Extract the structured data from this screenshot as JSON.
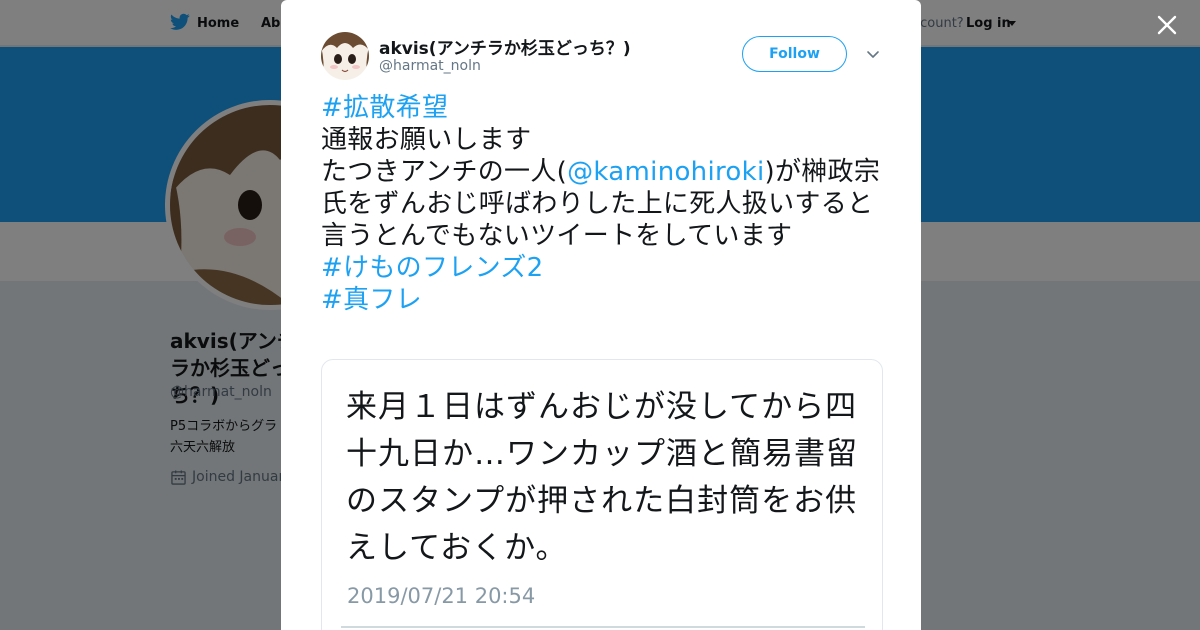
{
  "nav": {
    "home_label": "Home",
    "about_label": "Abo",
    "account_prompt": "account?",
    "login_label": "Log in"
  },
  "profile": {
    "name": "akvis(アンチラか杉玉どっち？)",
    "name_visible": "akvis(アンチラか杉玉どっち？)",
    "handle": "@harmat_noln",
    "bio": "P5コラボからグラ です 六天六解放",
    "joined": "Joined January"
  },
  "tweet": {
    "author_name": "akvis(アンチラか杉玉どっち？)",
    "author_handle": "@harmat_noln",
    "follow_label": "Follow",
    "hashtag_1": "#拡散希望",
    "line_1": "通報お願いします",
    "line_2_before": "たつきアンチの一人(",
    "mention": "@kaminohiroki",
    "line_2_after": ")が榊政宗氏をずんおじ呼ばわりした上に死人扱いすると言うとんでもないツイートをしています",
    "hashtag_2": "#けものフレンズ2",
    "hashtag_3": "#真フレ"
  },
  "media": {
    "text": "来月１日はずんおじが没してから四十九日か…ワンカップ酒と簡易書留のスタンプが押された白封筒をお供えしておくか。",
    "date": "2019/07/21 20:54"
  },
  "colors": {
    "accent": "#1da1f2",
    "text": "#14171a",
    "muted": "#657786"
  },
  "icons": [
    "twitter-bird-icon",
    "chevron-down-icon",
    "calendar-icon",
    "close-icon",
    "more-caret-icon"
  ]
}
